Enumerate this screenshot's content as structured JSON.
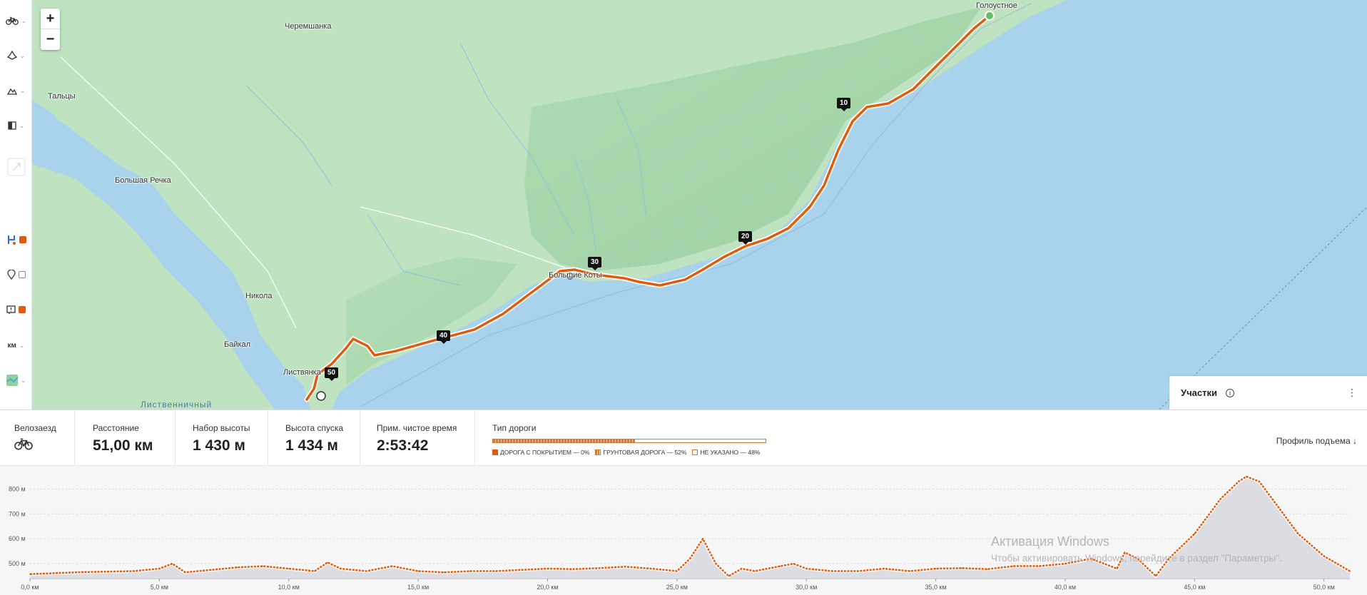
{
  "sidebar": {
    "items": [
      {
        "icon": "bicycle-icon",
        "chevron": true
      },
      {
        "icon": "road-surface-icon",
        "chevron": true
      },
      {
        "icon": "mountain-icon",
        "chevron": true
      },
      {
        "icon": "contrast-icon",
        "chevron": true
      },
      {
        "icon": "expand-icon",
        "chevron": false
      },
      {
        "icon": "route-icon",
        "checked": true
      },
      {
        "icon": "map-pin-icon",
        "checked": false
      },
      {
        "icon": "alert-icon",
        "checked": true
      },
      {
        "label": "км",
        "chevron": true
      },
      {
        "icon": "map-layer-icon",
        "chevron": true
      }
    ],
    "units_label": "км"
  },
  "map": {
    "zoom_in": "+",
    "zoom_out": "−",
    "places": {
      "goloustnoe": "Голоустное",
      "cheremshanka": "Черемшанка",
      "taltsy": "Тальцы",
      "bolshaya_rechka": "Большая Речка",
      "nikola": "Никола",
      "baikal": "Байкал",
      "listvyanka": "Листвянка",
      "bolshie_koty": "Большие Коты",
      "listvennichny": "Лиственничный"
    },
    "km_markers": [
      "10",
      "20",
      "30",
      "40",
      "50"
    ],
    "colors": {
      "land": "#b9dfbd",
      "water": "#a9d3ec",
      "route": "#e05a0c"
    }
  },
  "segments_panel": {
    "title": "Участки",
    "info": "i",
    "menu": "⋮"
  },
  "stats": {
    "ride_type": {
      "label": "Велозаезд",
      "icon": "bicycle-icon"
    },
    "distance": {
      "label": "Расстояние",
      "value": "51,00 км"
    },
    "elevation_gain": {
      "label": "Набор высоты",
      "value": "1 430 м"
    },
    "elevation_loss": {
      "label": "Высота спуска",
      "value": "1 434 м"
    },
    "est_time": {
      "label": "Прим. чистое время",
      "value": "2:53:42"
    },
    "road_type": {
      "label": "Тип дороги",
      "paved_fraction": 0.52,
      "legend": [
        "ДОРОГА С ПОКРЫТИЕМ — 0%",
        "ГРУНТОВАЯ ДОРОГА — 52%",
        "НЕ УКАЗАНО — 48%"
      ]
    },
    "profile_link": "Профиль подъема ↓"
  },
  "chart_data": {
    "type": "area",
    "xlabel": "",
    "ylabel": "",
    "xlim": [
      0,
      51
    ],
    "ylim": [
      440,
      870
    ],
    "x_ticks": [
      "0,0 км",
      "5,0 км",
      "10,0 км",
      "15,0 км",
      "20,0 км",
      "25,0 км",
      "30,0 км",
      "35,0 км",
      "40,0 км",
      "45,0 км",
      "50,0 км"
    ],
    "y_ticks": [
      "500 м",
      "600 м",
      "700 м",
      "800 м"
    ],
    "grid": true,
    "series": [
      {
        "x": [
          0,
          1,
          2,
          3,
          4,
          5,
          5.5,
          6,
          7,
          8,
          9,
          10,
          11,
          11.5,
          12,
          13,
          14,
          15,
          16,
          17,
          18,
          19,
          20,
          21,
          22,
          23,
          24,
          25,
          25.5,
          26,
          26.5,
          27,
          27.5,
          28,
          29,
          29.5,
          30,
          31,
          32,
          33,
          34,
          35,
          36,
          37,
          38,
          39,
          40,
          41,
          42,
          42.3,
          42.8,
          43.5,
          44,
          45,
          46,
          46.7,
          47,
          47.5,
          48,
          49,
          50,
          51
        ],
        "y": [
          458,
          462,
          466,
          468,
          470,
          480,
          500,
          465,
          475,
          485,
          490,
          480,
          470,
          505,
          480,
          470,
          490,
          470,
          465,
          470,
          470,
          475,
          480,
          478,
          482,
          488,
          480,
          470,
          520,
          600,
          500,
          450,
          480,
          470,
          490,
          500,
          480,
          470,
          470,
          480,
          470,
          480,
          482,
          478,
          490,
          490,
          500,
          520,
          480,
          545,
          520,
          450,
          520,
          620,
          760,
          830,
          850,
          830,
          760,
          620,
          530,
          470
        ]
      }
    ]
  },
  "watermark": {
    "line1": "Активация Windows",
    "line2": "Чтобы активировать Windows, перейдите в раздел \"Параметры\"."
  }
}
